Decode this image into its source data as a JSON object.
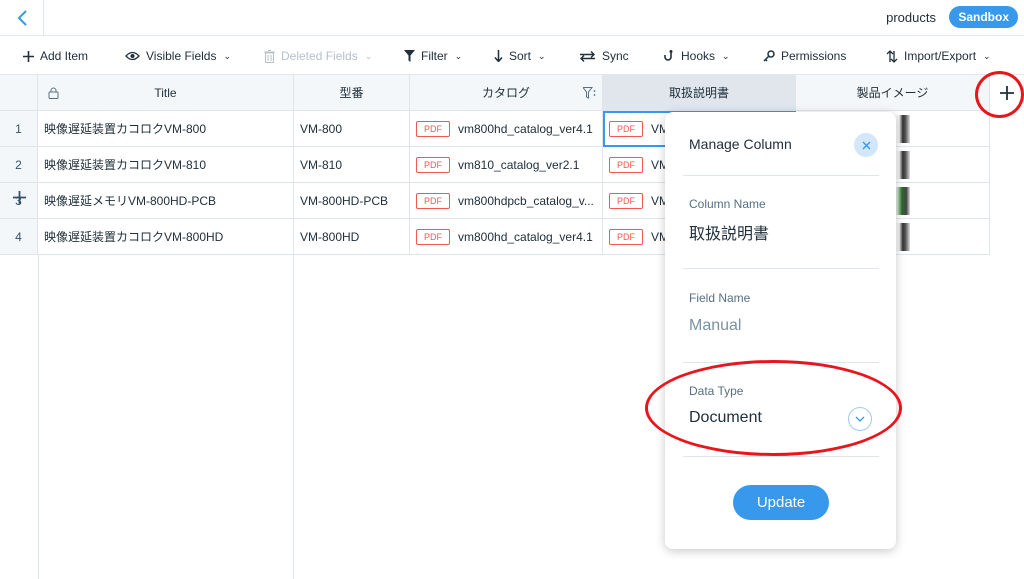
{
  "header": {
    "collection_name": "products",
    "mode_badge": "Sandbox"
  },
  "toolbar": {
    "add_item": "Add Item",
    "visible_fields": "Visible Fields",
    "deleted_fields": "Deleted Fields",
    "filter": "Filter",
    "sort": "Sort",
    "sync": "Sync",
    "hooks": "Hooks",
    "permissions": "Permissions",
    "import_export": "Import/Export"
  },
  "table": {
    "columns": [
      "Title",
      "型番",
      "カタログ",
      "取扱説明書",
      "製品イメージ"
    ],
    "pdf_badge": "PDF",
    "rows": [
      {
        "num": "1",
        "title": "映像遅延装置カコロクVM-800",
        "model": "VM-800",
        "catalog": "vm800hd_catalog_ver4.1",
        "manual": "VM"
      },
      {
        "num": "2",
        "title": "映像遅延装置カコロクVM-810",
        "model": "VM-810",
        "catalog": "vm810_catalog_ver2.1",
        "manual": "VM"
      },
      {
        "num": "3",
        "title": "映像遅延メモリVM-800HD-PCB",
        "model": "VM-800HD-PCB",
        "catalog": "vm800hdpcb_catalog_v...",
        "manual": "VM"
      },
      {
        "num": "4",
        "title": "映像遅延装置カコロクVM-800HD",
        "model": "VM-800HD",
        "catalog": "vm800hd_catalog_ver4.1",
        "manual": "VM"
      }
    ]
  },
  "panel": {
    "title": "Manage Column",
    "column_name_label": "Column Name",
    "column_name_value": "取扱説明書",
    "field_name_label": "Field Name",
    "field_name_value": "Manual",
    "data_type_label": "Data Type",
    "data_type_value": "Document",
    "update_button": "Update"
  },
  "colors": {
    "accent": "#3899ec",
    "annotation": "#e8161c",
    "pdf": "#ee5951"
  }
}
